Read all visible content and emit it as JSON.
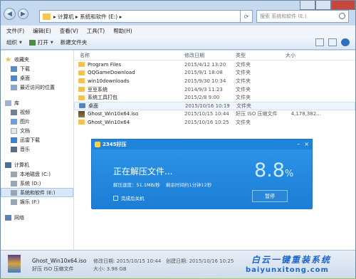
{
  "address": {
    "path": "▸ 计算机 ▸ 系统和软件 (E:) ▸",
    "search_placeholder": "搜索 系统和软件 (E:)"
  },
  "menu": [
    "文件(F)",
    "编辑(E)",
    "查看(V)",
    "工具(T)",
    "帮助(H)"
  ],
  "toolbar": {
    "organize": "组织",
    "open": "打开",
    "new_folder": "新建文件夹"
  },
  "sidebar": {
    "favorites": "收藏夹",
    "fav_items": [
      "下载",
      "桌面",
      "最近访问的位置"
    ],
    "libraries": "库",
    "lib_items": [
      "视频",
      "图片",
      "文档",
      "迅雷下载",
      "音乐"
    ],
    "computer": "计算机",
    "drives": [
      "本地磁盘 (C:)",
      "系统 (D:)",
      "系统和软件 (E:)",
      "娱乐 (F:)"
    ],
    "network": "网络"
  },
  "columns": {
    "name": "名称",
    "date": "修改日期",
    "type": "类型",
    "size": "大小"
  },
  "files": [
    {
      "name": "Program Files",
      "date": "2015/4/12 13:20",
      "type": "文件夹",
      "size": ""
    },
    {
      "name": "QQGameDownload",
      "date": "2015/9/1 18:08",
      "type": "文件夹",
      "size": ""
    },
    {
      "name": "win10downloads",
      "date": "2015/9/30 10:34",
      "type": "文件夹",
      "size": ""
    },
    {
      "name": "豆豆系统",
      "date": "2014/9/3 11:23",
      "type": "文件夹",
      "size": ""
    },
    {
      "name": "系统工具打包",
      "date": "2015/2/8 9:00",
      "type": "文件夹",
      "size": ""
    },
    {
      "name": "桌面",
      "date": "2015/10/16 10:19",
      "type": "文件夹",
      "size": ""
    },
    {
      "name": "Ghost_Win10x64.iso",
      "date": "2015/10/15 10:44",
      "type": "好压 ISO 压缩文件",
      "size": "4,178,382..."
    },
    {
      "name": "Ghost_Win10x64",
      "date": "2015/10/16 10:25",
      "type": "文件夹",
      "size": ""
    }
  ],
  "dialog": {
    "title": "2345好压",
    "status": "正在解压文件...",
    "percent": "8.8",
    "percent_sign": "%",
    "speed_label": "解压速度：",
    "speed": "51.1MB/秒",
    "remaining_label": "剩余时间约1分钟12秒",
    "checkbox": "完成后关机",
    "pause": "暂停"
  },
  "details": {
    "name": "Ghost_Win10x64.iso",
    "type": "好压 ISO 压缩文件",
    "modified": "修改日期: 2015/10/15 10:44",
    "size": "大小: 3.98 GB",
    "created": "创建日期: 2015/10/16 10:25"
  },
  "watermark": {
    "line1": "白云一键重装系统",
    "line2": "baiyunxitong.com"
  }
}
